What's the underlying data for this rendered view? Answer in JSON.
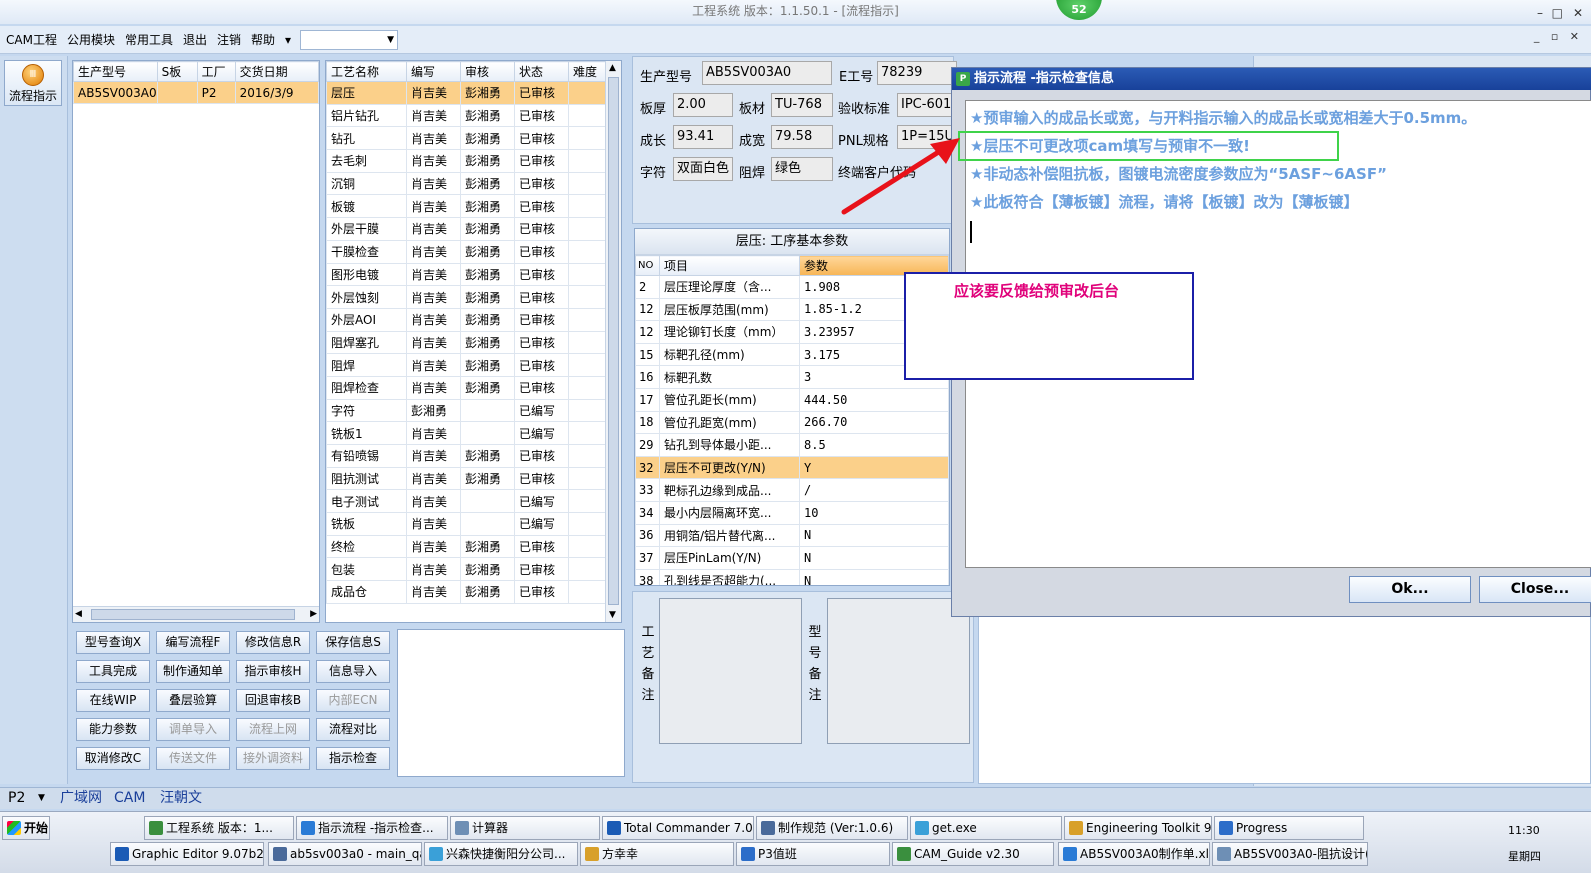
{
  "window": {
    "title": "工程系统  版本：1.1.50.1 - [流程指示]",
    "minimize": "–",
    "maximize": "□",
    "close": "✕",
    "badge_count": "52"
  },
  "menu": {
    "items": [
      "CAM工程",
      "公用模块",
      "常用工具",
      "退出",
      "注销",
      "帮助"
    ],
    "help_arrow": "▾",
    "mdi_controls": "_ ▫ ✕"
  },
  "left_nav": {
    "flow_button": "流程指示"
  },
  "model_grid": {
    "headers": [
      "生产型号",
      "S板",
      "工厂",
      "交货日期"
    ],
    "rows": [
      {
        "model": "AB5SV003A0",
        "s": "",
        "factory": "P2",
        "date": "2016/3/9"
      }
    ]
  },
  "process_grid": {
    "headers": [
      "工艺名称",
      "编写",
      "审核",
      "状态",
      "难度"
    ],
    "rows": [
      [
        "层压",
        "肖吉美",
        "彭湘勇",
        "已审核"
      ],
      [
        "铝片钻孔",
        "肖吉美",
        "彭湘勇",
        "已审核"
      ],
      [
        "钻孔",
        "肖吉美",
        "彭湘勇",
        "已审核"
      ],
      [
        "去毛刺",
        "肖吉美",
        "彭湘勇",
        "已审核"
      ],
      [
        "沉铜",
        "肖吉美",
        "彭湘勇",
        "已审核"
      ],
      [
        "板镀",
        "肖吉美",
        "彭湘勇",
        "已审核"
      ],
      [
        "外层干膜",
        "肖吉美",
        "彭湘勇",
        "已审核"
      ],
      [
        "干膜检查",
        "肖吉美",
        "彭湘勇",
        "已审核"
      ],
      [
        "图形电镀",
        "肖吉美",
        "彭湘勇",
        "已审核"
      ],
      [
        "外层蚀刻",
        "肖吉美",
        "彭湘勇",
        "已审核"
      ],
      [
        "外层AOI",
        "肖吉美",
        "彭湘勇",
        "已审核"
      ],
      [
        "阻焊塞孔",
        "肖吉美",
        "彭湘勇",
        "已审核"
      ],
      [
        "阻焊",
        "肖吉美",
        "彭湘勇",
        "已审核"
      ],
      [
        "阻焊检查",
        "肖吉美",
        "彭湘勇",
        "已审核"
      ],
      [
        "字符",
        "彭湘勇",
        "",
        "已编写"
      ],
      [
        "铣板1",
        "肖吉美",
        "",
        "已编写"
      ],
      [
        "有铅喷锡",
        "肖吉美",
        "彭湘勇",
        "已审核"
      ],
      [
        "阻抗测试",
        "肖吉美",
        "彭湘勇",
        "已审核"
      ],
      [
        "电子测试",
        "肖吉美",
        "",
        "已编写"
      ],
      [
        "铣板",
        "肖吉美",
        "",
        "已编写"
      ],
      [
        "终检",
        "肖吉美",
        "彭湘勇",
        "已审核"
      ],
      [
        "包装",
        "肖吉美",
        "彭湘勇",
        "已审核"
      ],
      [
        "成品仓",
        "肖吉美",
        "彭湘勇",
        "已审核"
      ]
    ]
  },
  "actions": [
    {
      "label": "型号查询X",
      "enabled": true
    },
    {
      "label": "编写流程F",
      "enabled": true
    },
    {
      "label": "修改信息R",
      "enabled": true
    },
    {
      "label": "保存信息S",
      "enabled": true
    },
    {
      "label": "工具完成",
      "enabled": true
    },
    {
      "label": "制作通知单",
      "enabled": true
    },
    {
      "label": "指示审核H",
      "enabled": true
    },
    {
      "label": "信息导入",
      "enabled": true
    },
    {
      "label": "在线WIP",
      "enabled": true
    },
    {
      "label": "叠层验算",
      "enabled": true
    },
    {
      "label": "回退审核B",
      "enabled": true
    },
    {
      "label": "内部ECN",
      "enabled": false
    },
    {
      "label": "能力参数",
      "enabled": true
    },
    {
      "label": "调单导入",
      "enabled": false
    },
    {
      "label": "流程上网",
      "enabled": false
    },
    {
      "label": "流程对比",
      "enabled": true
    },
    {
      "label": "取消修改C",
      "enabled": true
    },
    {
      "label": "传送文件",
      "enabled": false
    },
    {
      "label": "接外调资料",
      "enabled": false
    },
    {
      "label": "指示检查",
      "enabled": true
    }
  ],
  "info": {
    "model_label": "生产型号",
    "model": "AB5SV003A0",
    "eno_label": "E工号",
    "eno": "78239",
    "thickness_label": "板厚",
    "thickness": "2.00",
    "material_label": "板材",
    "material": "TU-768",
    "standard_label": "验收标准",
    "standard": "IPC-601",
    "length_label": "成长",
    "length": "93.41",
    "width_label": "成宽",
    "width": "79.58",
    "pnl_label": "PNL规格",
    "pnl": "1P=15U",
    "char_label": "字符",
    "char": "双面白色",
    "mask_label": "阻焊",
    "mask": "绿色",
    "customer_label": "终端客户代码"
  },
  "params": {
    "title": "层压: 工序基本参数",
    "headers": [
      "NO",
      "项目",
      "参数"
    ],
    "rows": [
      [
        "2",
        "层压理论厚度（含...",
        "1.908"
      ],
      [
        "12",
        "层压板厚范围(mm)",
        "1.85-1.2"
      ],
      [
        "12",
        "理论铆钉长度（mm）",
        "3.23957"
      ],
      [
        "15",
        "标靶孔径(mm)",
        "3.175"
      ],
      [
        "16",
        "标靶孔数",
        "3"
      ],
      [
        "17",
        "管位孔距长(mm)",
        "444.50"
      ],
      [
        "18",
        "管位孔距宽(mm)",
        "266.70"
      ],
      [
        "29",
        "钻孔到导体最小距...",
        "8.5"
      ],
      [
        "32",
        "层压不可更改(Y/N)",
        "Y"
      ],
      [
        "33",
        "靶标孔边缘到成品...",
        "/"
      ],
      [
        "34",
        "最小内层隔离环宽...",
        "10"
      ],
      [
        "36",
        "用铜箔/铝片替代离...",
        "N"
      ],
      [
        "37",
        "层压PinLam(Y/N)",
        "N"
      ],
      [
        "38",
        "孔到线是否超能力(...",
        "N"
      ]
    ]
  },
  "memos": {
    "process_label": "工艺备注",
    "model_label": "型号备注"
  },
  "dialog": {
    "title": "指示流程 -指示检查信息",
    "messages": [
      "★预审输入的成品长或宽，与开料指示输入的成品长或宽相差大于0.5mm。",
      "★层压不可更改项cam填写与预审不一致!",
      "★非动态补偿阻抗板，图镀电流密度参数应为“5ASF~6ASF”",
      "★此板符合【薄板镀】流程，请将【板镀】改为【薄板镀】"
    ],
    "ok": "Ok...",
    "close": "Close..."
  },
  "annotation": {
    "text": "应该要反馈给预审改后台"
  },
  "statusbar": {
    "factory": "P2",
    "cells": [
      "广域网",
      "CAM",
      "汪朝文"
    ]
  },
  "taskbar": {
    "start": "开始",
    "row1": [
      "工程系统 版本：1...",
      "指示流程 -指示检查...",
      "计算器",
      "Total Commander 7.0 p...",
      "制作规范 (Ver:1.0.6)",
      "get.exe",
      "Engineering Toolkit 9.0...",
      "Progress"
    ],
    "row2": [
      "Graphic Editor 9.07b2 (0...",
      "ab5sv003a0 - main_qa",
      "兴森快捷衡阳分公司...",
      "方幸幸",
      "P3值班",
      "CAM_Guide v2.30",
      "AB5SV003A0制作单.xls ...",
      "AB5SV003A0-阻抗设计(..."
    ],
    "time": "11:30",
    "day": "星期四"
  },
  "colors": {
    "dialog_msg": "#6ca0de",
    "annotation": "#e0007a",
    "highlight_box": "#3fd34a",
    "note_box": "#1b1fa8",
    "arrow": "#e8121a",
    "selected_row": "#fbd08a"
  }
}
